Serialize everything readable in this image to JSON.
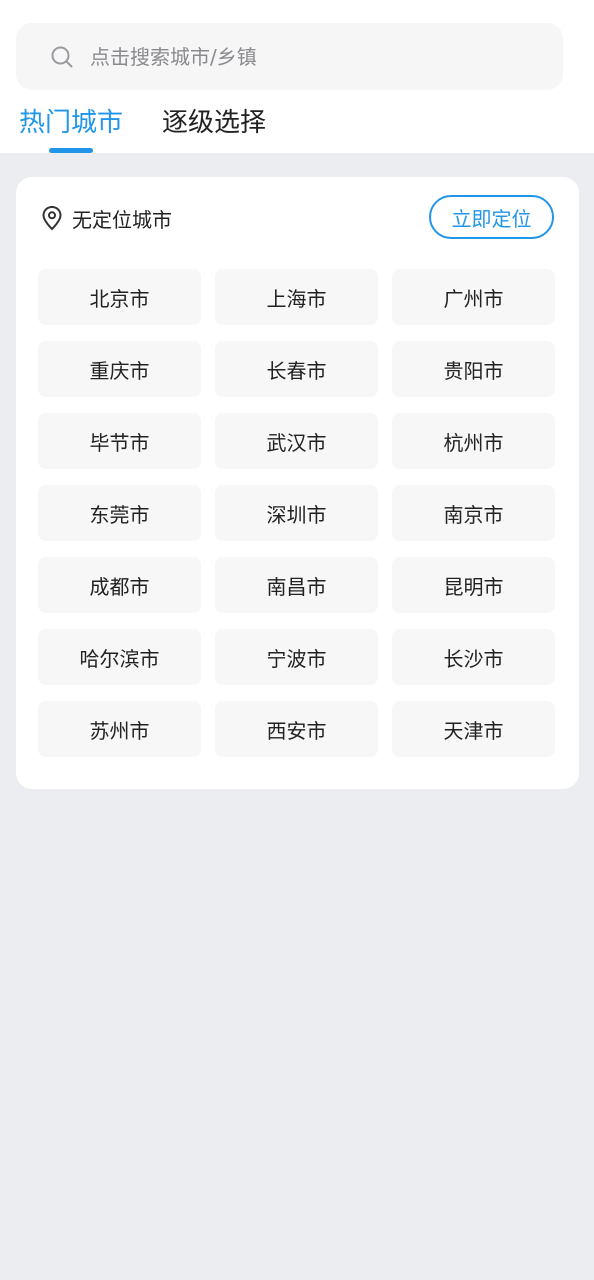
{
  "search": {
    "placeholder": "点击搜索城市/乡镇"
  },
  "tabs": [
    {
      "label": "热门城市",
      "active": true
    },
    {
      "label": "逐级选择",
      "active": false
    }
  ],
  "location": {
    "status": "无定位城市",
    "locate_button": "立即定位",
    "icon": "map-pin-icon"
  },
  "cities": [
    "北京市",
    "上海市",
    "广州市",
    "重庆市",
    "长春市",
    "贵阳市",
    "毕节市",
    "武汉市",
    "杭州市",
    "东莞市",
    "深圳市",
    "南京市",
    "成都市",
    "南昌市",
    "昆明市",
    "哈尔滨市",
    "宁波市",
    "长沙市",
    "苏州市",
    "西安市",
    "天津市"
  ],
  "colors": {
    "accent": "#2196e8",
    "background": "#ebedf0",
    "card": "#ffffff",
    "chip": "#f7f7f8"
  }
}
